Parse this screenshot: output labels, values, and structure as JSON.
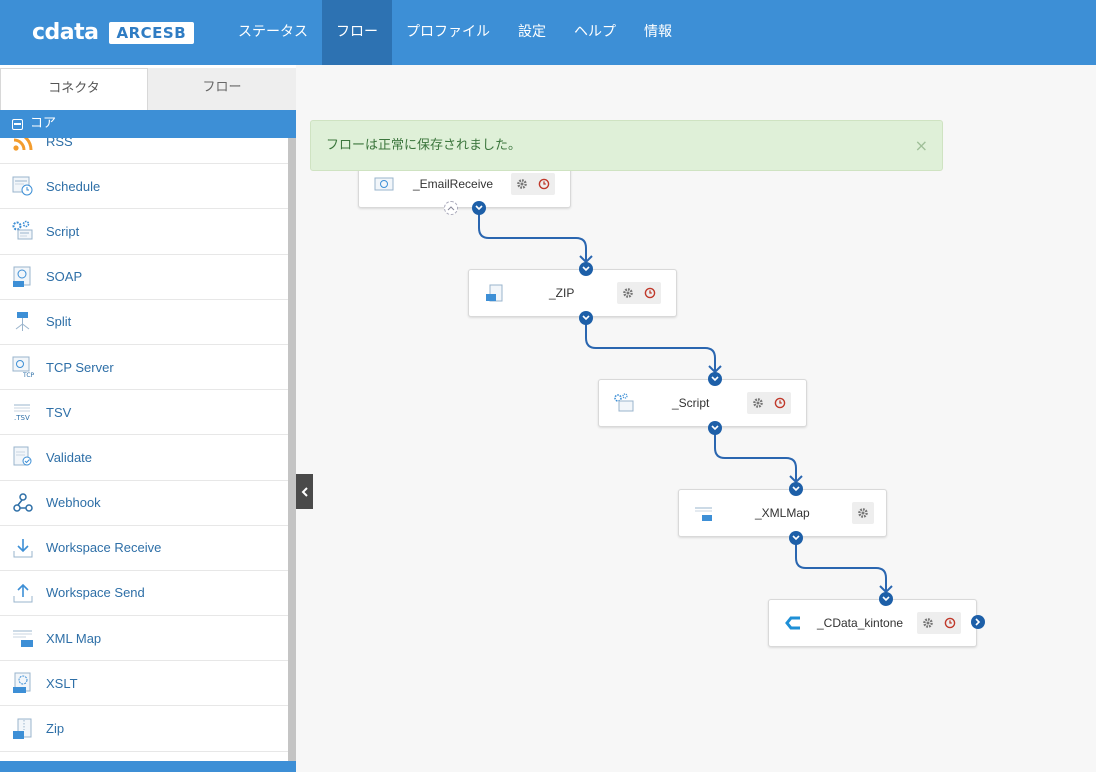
{
  "app": {
    "brand_name": "cdata",
    "product": "ARCESB"
  },
  "nav": [
    {
      "label": "ステータス",
      "active": false
    },
    {
      "label": "フロー",
      "active": true
    },
    {
      "label": "プロファイル",
      "active": false
    },
    {
      "label": "設定",
      "active": false
    },
    {
      "label": "ヘルプ",
      "active": false
    },
    {
      "label": "情報",
      "active": false
    }
  ],
  "sidebar": {
    "tabs": [
      {
        "label": "コネクタ",
        "active": true
      },
      {
        "label": "フロー",
        "active": false
      }
    ],
    "section": "コア",
    "items": [
      {
        "label": "RSS",
        "icon": "rss-icon"
      },
      {
        "label": "Schedule",
        "icon": "schedule-icon"
      },
      {
        "label": "Script",
        "icon": "script-icon"
      },
      {
        "label": "SOAP",
        "icon": "soap-icon"
      },
      {
        "label": "Split",
        "icon": "split-icon"
      },
      {
        "label": "TCP Server",
        "icon": "tcp-server-icon"
      },
      {
        "label": "TSV",
        "icon": "tsv-icon"
      },
      {
        "label": "Validate",
        "icon": "validate-icon"
      },
      {
        "label": "Webhook",
        "icon": "webhook-icon"
      },
      {
        "label": "Workspace Receive",
        "icon": "workspace-receive-icon"
      },
      {
        "label": "Workspace Send",
        "icon": "workspace-send-icon"
      },
      {
        "label": "XML Map",
        "icon": "xml-map-icon"
      },
      {
        "label": "XSLT",
        "icon": "xslt-icon"
      },
      {
        "label": "Zip",
        "icon": "zip-icon"
      }
    ]
  },
  "alert": {
    "message": "フローは正常に保存されました。",
    "close": "×"
  },
  "flow": {
    "nodes": [
      {
        "label": "_EmailReceive",
        "icon": "email-receive-icon"
      },
      {
        "label": "_ZIP",
        "icon": "zip-icon"
      },
      {
        "label": "_Script",
        "icon": "script-icon"
      },
      {
        "label": "_XMLMap",
        "icon": "xml-map-icon"
      },
      {
        "label": "_CData_kintone",
        "icon": "cdata-icon"
      }
    ]
  },
  "colors": {
    "topbar": "#3d8fd6",
    "nav_active": "#2d72b2",
    "port": "#1d5fa8",
    "connector_line": "#2a66b0",
    "alert_bg": "#dff0d8",
    "alert_text": "#3c763d",
    "schedule_button": "#c0392b"
  }
}
